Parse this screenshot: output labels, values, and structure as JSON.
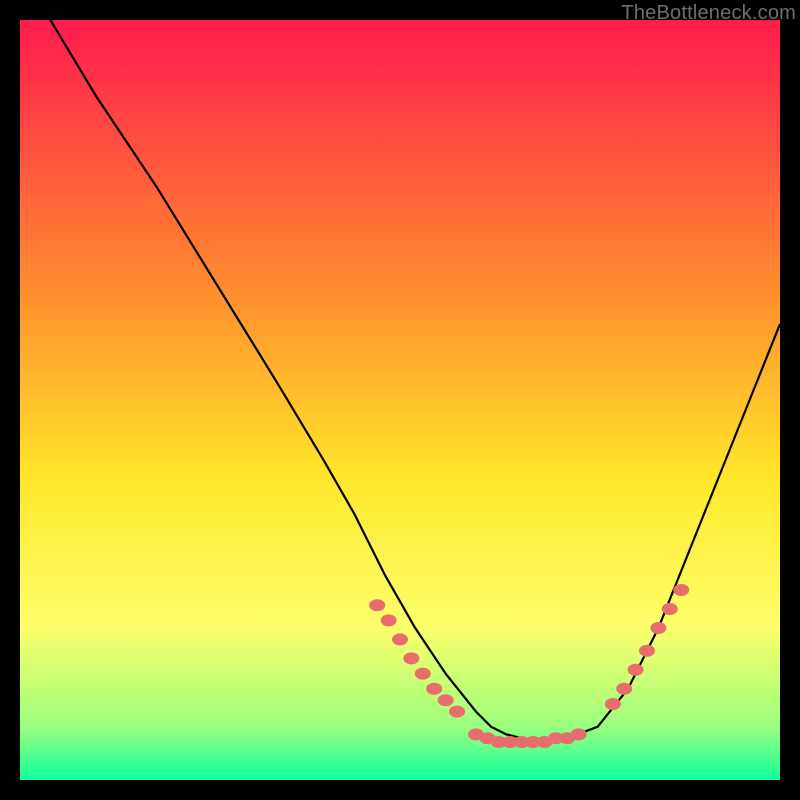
{
  "watermark": "TheBottleneck.com",
  "colors": {
    "gradient_top": "#ff1b4e",
    "gradient_mid1": "#ff8b2e",
    "gradient_mid2": "#ffe62a",
    "gradient_mid3": "#fdff6b",
    "gradient_bottom_band": "#9bff7f",
    "gradient_bottom": "#10ff9e",
    "curve": "#000000",
    "dots": "#e86d6d",
    "watermark": "#6e6e6e"
  },
  "chart_data": {
    "type": "line",
    "title": "",
    "xlabel": "",
    "ylabel": "",
    "xlim": [
      0,
      100
    ],
    "ylim": [
      0,
      100
    ],
    "grid": false,
    "legend": false,
    "series": [
      {
        "name": "curve",
        "x": [
          4,
          10,
          18,
          26,
          34,
          40,
          44,
          48,
          52,
          56,
          60,
          62,
          63,
          64,
          68,
          72,
          76,
          80,
          84,
          88,
          92,
          96,
          100
        ],
        "y": [
          100,
          90,
          78,
          65,
          52,
          42,
          35,
          27,
          20,
          14,
          9,
          7,
          6.5,
          6,
          5,
          5.5,
          7,
          12,
          20,
          30,
          40,
          50,
          60
        ]
      }
    ],
    "scatter": [
      {
        "name": "left-cluster-dots",
        "x": [
          47,
          48.5,
          50,
          51.5,
          53,
          54.5,
          56,
          57.5
        ],
        "y": [
          23,
          21,
          18.5,
          16,
          14,
          12,
          10.5,
          9
        ]
      },
      {
        "name": "valley-dots",
        "x": [
          60,
          61.5,
          63,
          64.5,
          66,
          67.5,
          69,
          70.5,
          72,
          73.5
        ],
        "y": [
          6,
          5.5,
          5,
          5,
          5,
          5,
          5,
          5.5,
          5.5,
          6
        ]
      },
      {
        "name": "right-cluster-dots",
        "x": [
          78,
          79.5,
          81,
          82.5,
          84,
          85.5,
          87
        ],
        "y": [
          10,
          12,
          14.5,
          17,
          20,
          22.5,
          25
        ]
      }
    ]
  }
}
